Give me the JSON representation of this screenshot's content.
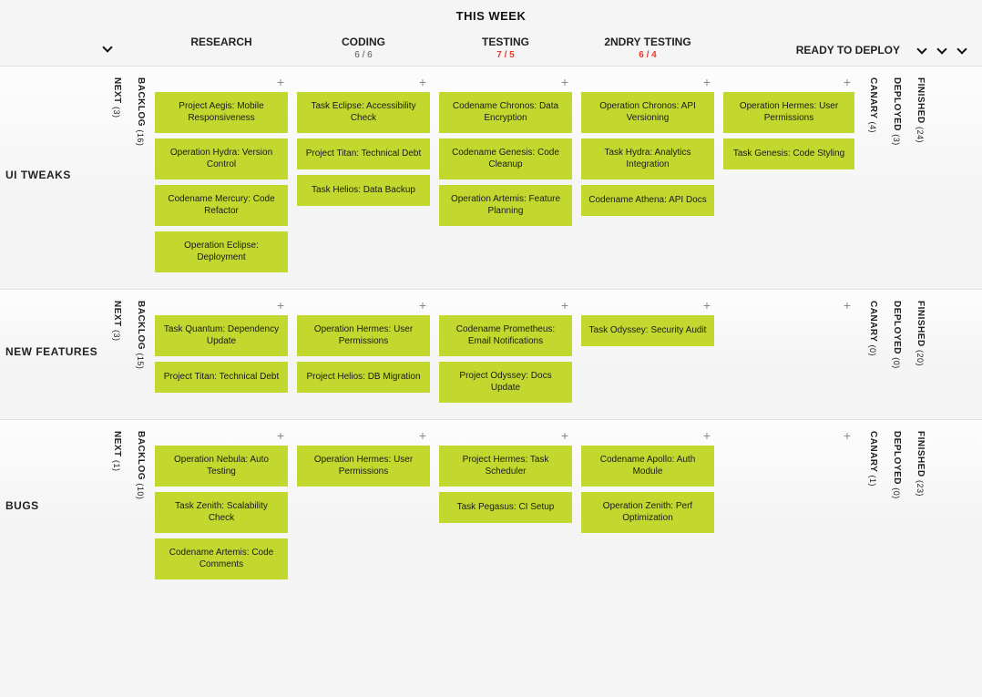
{
  "section_title": "THIS WEEK",
  "ready_label": "READY TO DEPLOY",
  "columns": {
    "research": {
      "label": "RESEARCH",
      "wip": ""
    },
    "coding": {
      "label": "CODING",
      "wip": "6 / 6"
    },
    "testing": {
      "label": "TESTING",
      "wip": "7 / 5",
      "over": true
    },
    "secondary": {
      "label": "2NDRY TESTING",
      "wip": "6 / 4",
      "over": true
    }
  },
  "side_left": {
    "next_label": "NEXT",
    "backlog_label": "BACKLOG"
  },
  "side_right": {
    "canary_label": "CANARY",
    "deployed_label": "DEPLOYED",
    "finished_label": "FINISHED"
  },
  "lanes": [
    {
      "name": "UI TWEAKS",
      "left": {
        "next": 3,
        "backlog": 16
      },
      "right": {
        "canary": 4,
        "deployed": 3,
        "finished": 24
      },
      "research": [
        "Project Aegis: Mobile Responsiveness",
        "Operation Hydra: Version Control",
        "Codename Mercury: Code Refactor",
        "Operation Eclipse: Deployment"
      ],
      "coding": [
        "Task Eclipse: Accessibility Check",
        "Project Titan: Technical Debt",
        "Task Helios: Data Backup"
      ],
      "testing": [
        "Codename Chronos: Data Encryption",
        "Codename Genesis: Code Cleanup",
        "Operation Artemis: Feature Planning"
      ],
      "secondary": [
        "Operation Chronos: API Versioning",
        "Task Hydra: Analytics Integration",
        "Codename Athena: API Docs"
      ],
      "ready": [
        "Operation Hermes: User Permissions",
        "Task Genesis: Code Styling"
      ]
    },
    {
      "name": "NEW FEATURES",
      "left": {
        "next": 3,
        "backlog": 15
      },
      "right": {
        "canary": 0,
        "deployed": 0,
        "finished": 20
      },
      "research": [
        "Task Quantum: Dependency Update",
        "Project Titan: Technical Debt"
      ],
      "coding": [
        "Operation Hermes: User Permissions",
        "Project Helios: DB Migration"
      ],
      "testing": [
        "Codename Prometheus: Email Notifications",
        "Project Odyssey: Docs Update"
      ],
      "secondary": [
        "Task Odyssey: Security Audit"
      ],
      "ready": []
    },
    {
      "name": "BUGS",
      "left": {
        "next": 1,
        "backlog": 10
      },
      "right": {
        "canary": 1,
        "deployed": 0,
        "finished": 23
      },
      "research": [
        "Operation Nebula: Auto Testing",
        "Task Zenith: Scalability Check",
        "Codename Artemis: Code Comments"
      ],
      "coding": [
        "Operation Hermes: User Permissions"
      ],
      "testing": [
        "Project Hermes: Task Scheduler",
        "Task Pegasus: CI Setup"
      ],
      "secondary": [
        "Codename Apollo: Auth Module",
        "Operation Zenith: Perf Optimization"
      ],
      "ready": []
    }
  ]
}
